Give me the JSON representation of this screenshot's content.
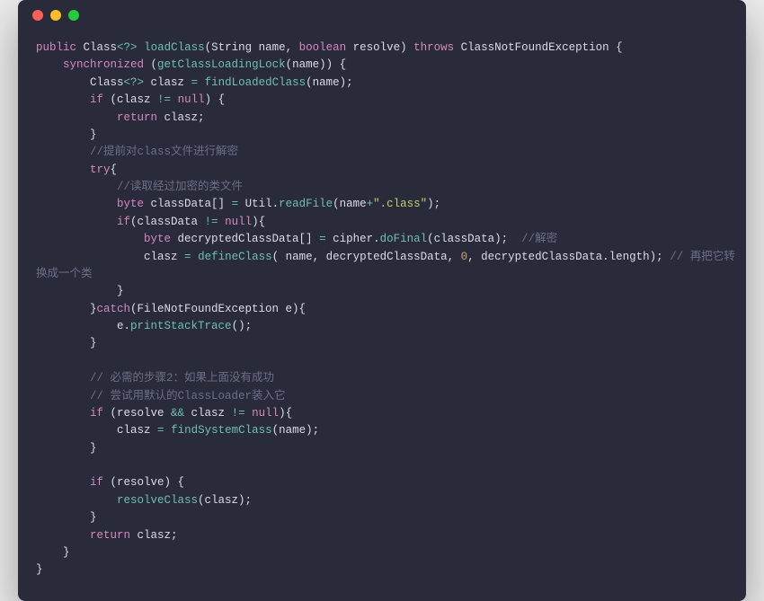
{
  "window": {
    "dots": [
      "red",
      "yellow",
      "green"
    ]
  },
  "code": {
    "l01": {
      "a": "public",
      "b": " Class",
      "c": "<?>",
      "d": " ",
      "e": "loadClass",
      "f": "(String name, ",
      "g": "boolean",
      "h": " resolve) ",
      "i": "throws",
      "j": " ClassNotFoundException {"
    },
    "l02": {
      "a": "    synchronized",
      "b": " (",
      "c": "getClassLoadingLock",
      "d": "(name)) {"
    },
    "l03": {
      "a": "        Class",
      "b": "<?>",
      "c": " clasz ",
      "d": "=",
      "e": " ",
      "f": "findLoadedClass",
      "g": "(name);"
    },
    "l04": {
      "a": "        if",
      "b": " (clasz ",
      "c": "!=",
      "d": " ",
      "e": "null",
      "f": ") {"
    },
    "l05": {
      "a": "            return",
      "b": " clasz;"
    },
    "l06": {
      "a": "        }"
    },
    "l07": {
      "a": "        //提前对class文件进行解密"
    },
    "l08": {
      "a": "        try",
      "b": "{"
    },
    "l09": {
      "a": "            //读取经过加密的类文件"
    },
    "l10": {
      "a": "            byte",
      "b": " classData[] ",
      "c": "=",
      "d": " Util.",
      "e": "readFile",
      "f": "(name",
      "g": "+",
      "h": "\".class\"",
      "i": ");"
    },
    "l11": {
      "a": "            if",
      "b": "(classData ",
      "c": "!=",
      "d": " ",
      "e": "null",
      "f": "){"
    },
    "l12": {
      "a": "                byte",
      "b": " decryptedClassData[] ",
      "c": "=",
      "d": " cipher.",
      "e": "doFinal",
      "f": "(classData);  ",
      "g": "//解密"
    },
    "l13": {
      "a": "                clasz ",
      "b": "=",
      "c": " ",
      "d": "defineClass",
      "e": "( name, decryptedClassData, ",
      "f": "0",
      "g": ", decryptedClassData.length); ",
      "h": "// 再把它转"
    },
    "l13b": {
      "a": "换成一个类"
    },
    "l14": {
      "a": "            }"
    },
    "l15": {
      "a": "        }",
      "b": "catch",
      "c": "(FileNotFoundException e){"
    },
    "l16": {
      "a": "            e.",
      "b": "printStackTrace",
      "c": "();"
    },
    "l17": {
      "a": "        }"
    },
    "l18": {
      "a": ""
    },
    "l19": {
      "a": "        // 必需的步骤2：如果上面没有成功"
    },
    "l20": {
      "a": "        // 尝试用默认的ClassLoader装入它"
    },
    "l21": {
      "a": "        if",
      "b": " (resolve ",
      "c": "&&",
      "d": " clasz ",
      "e": "!=",
      "f": " ",
      "g": "null",
      "h": "){"
    },
    "l22": {
      "a": "            clasz ",
      "b": "=",
      "c": " ",
      "d": "findSystemClass",
      "e": "(name);"
    },
    "l23": {
      "a": "        }"
    },
    "l24": {
      "a": ""
    },
    "l25": {
      "a": "        if",
      "b": " (resolve) {"
    },
    "l26": {
      "a": "            ",
      "b": "resolveClass",
      "c": "(clasz);"
    },
    "l27": {
      "a": "        }"
    },
    "l28": {
      "a": "        return",
      "b": " clasz;"
    },
    "l29": {
      "a": "    }"
    },
    "l30": {
      "a": "}"
    }
  }
}
